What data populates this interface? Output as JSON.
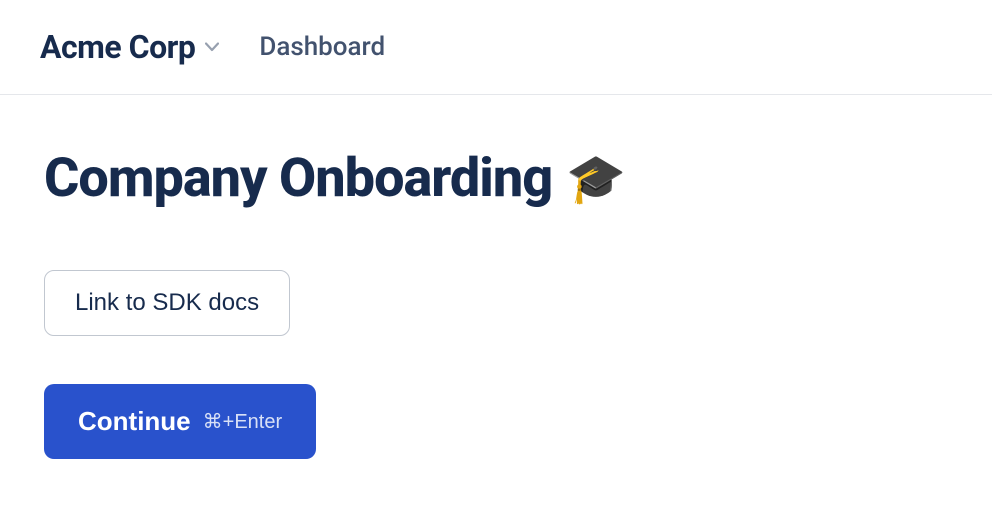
{
  "header": {
    "org_name": "Acme Corp",
    "nav": {
      "dashboard_label": "Dashboard"
    }
  },
  "main": {
    "title": "Company Onboarding",
    "title_emoji": "🎓",
    "link_button_label": "Link to SDK docs",
    "continue_button_label": "Continue",
    "continue_shortcut": "⌘+Enter"
  },
  "colors": {
    "primary": "#2952cc",
    "text": "#172b4d",
    "border": "#c1c7d0"
  }
}
